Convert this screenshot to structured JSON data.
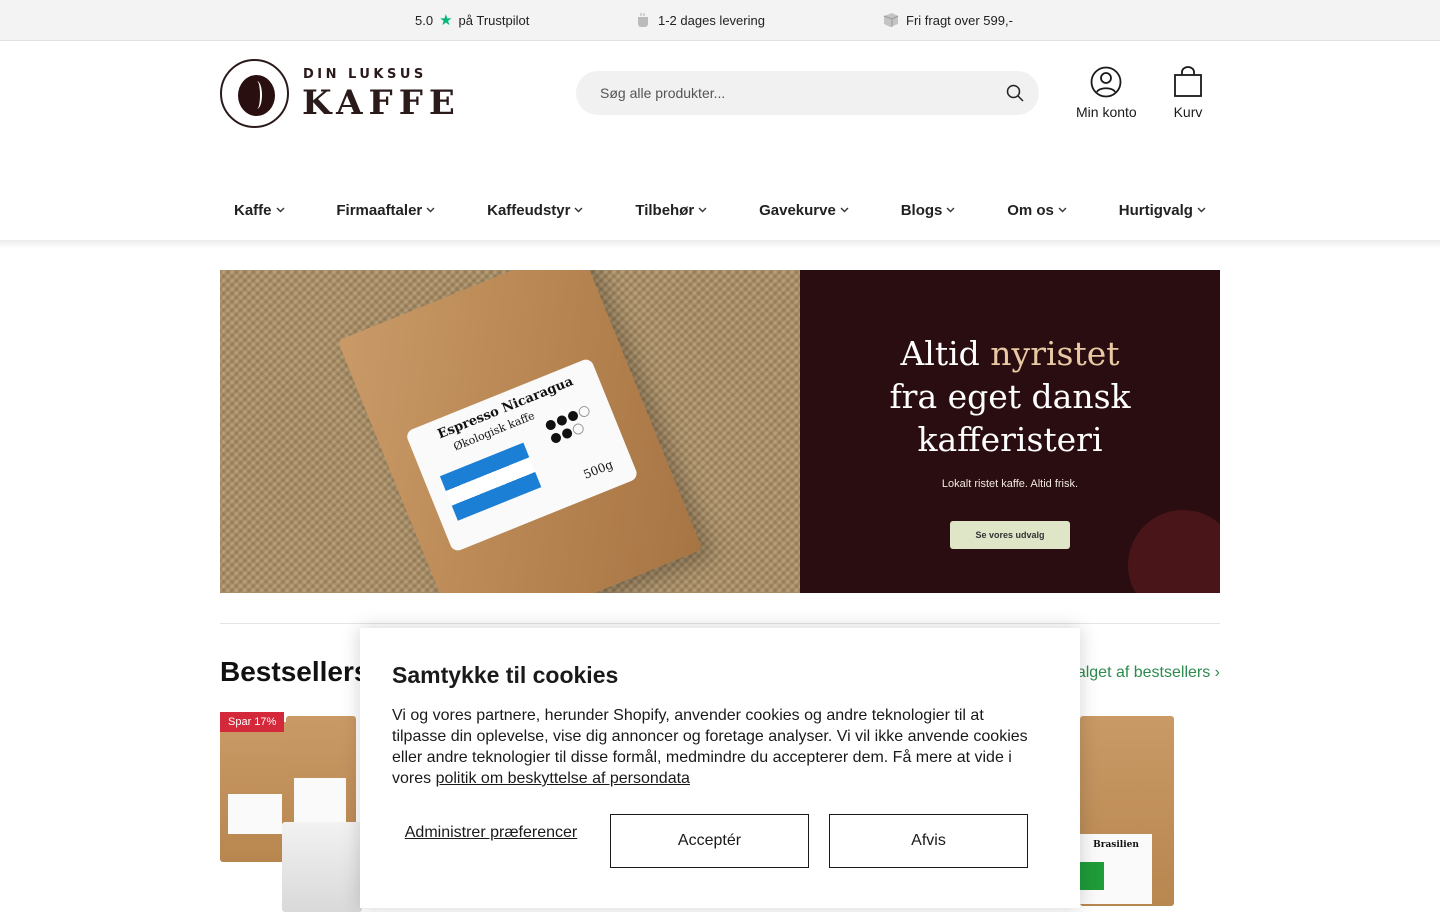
{
  "topbar": {
    "rating": "5.0",
    "trustpilot": "på Trustpilot",
    "delivery": "1-2 dages levering",
    "freight": "Fri fragt over 599,-"
  },
  "logo": {
    "sub": "DIN LUKSUS",
    "main": "KAFFE"
  },
  "search": {
    "placeholder": "Søg alle produkter..."
  },
  "header": {
    "account_label": "Min konto",
    "cart_label": "Kurv"
  },
  "nav": {
    "items": [
      {
        "label": "Kaffe"
      },
      {
        "label": "Firmaaftaler"
      },
      {
        "label": "Kaffeudstyr"
      },
      {
        "label": "Tilbehør"
      },
      {
        "label": "Gavekurve"
      },
      {
        "label": "Blogs"
      },
      {
        "label": "Om os"
      },
      {
        "label": "Hurtigvalg"
      }
    ]
  },
  "hero": {
    "headline_1a": "Altid ",
    "headline_1b": "nyristet",
    "headline_2": "fra eget dansk",
    "headline_3": "kafferisteri",
    "tagline": "Lokalt ristet kaffe. Altid frisk.",
    "cta": "Se vores udvalg",
    "bag_title": "Espresso Nicaragua",
    "bag_subtitle": "Økologisk kaffe",
    "bag_weight": "500g"
  },
  "bestsellers": {
    "title": "Bestsellers",
    "link": "Se hele udvalget af bestsellers ›",
    "badge": "Spar 17%",
    "bag_label": "Brasilien"
  },
  "cookie": {
    "title": "Samtykke til cookies",
    "body": "Vi og vores partnere, herunder Shopify, anvender cookies og andre teknologier til at tilpasse din oplevelse, vise dig annoncer og foretage analyser. Vi vil ikke anvende cookies eller andre teknologier til disse formål, medmindre du accepterer dem. Få mere at vide i vores ",
    "policy_link": "politik om beskyttelse af persondata",
    "manage": "Administrer præferencer",
    "accept": "Acceptér",
    "decline": "Afvis"
  },
  "colors": {
    "accent_green": "#2c8b4d",
    "trustpilot_green": "#00b67a",
    "hero_panel": "#2a0d10",
    "sale_badge": "#d4293a"
  }
}
